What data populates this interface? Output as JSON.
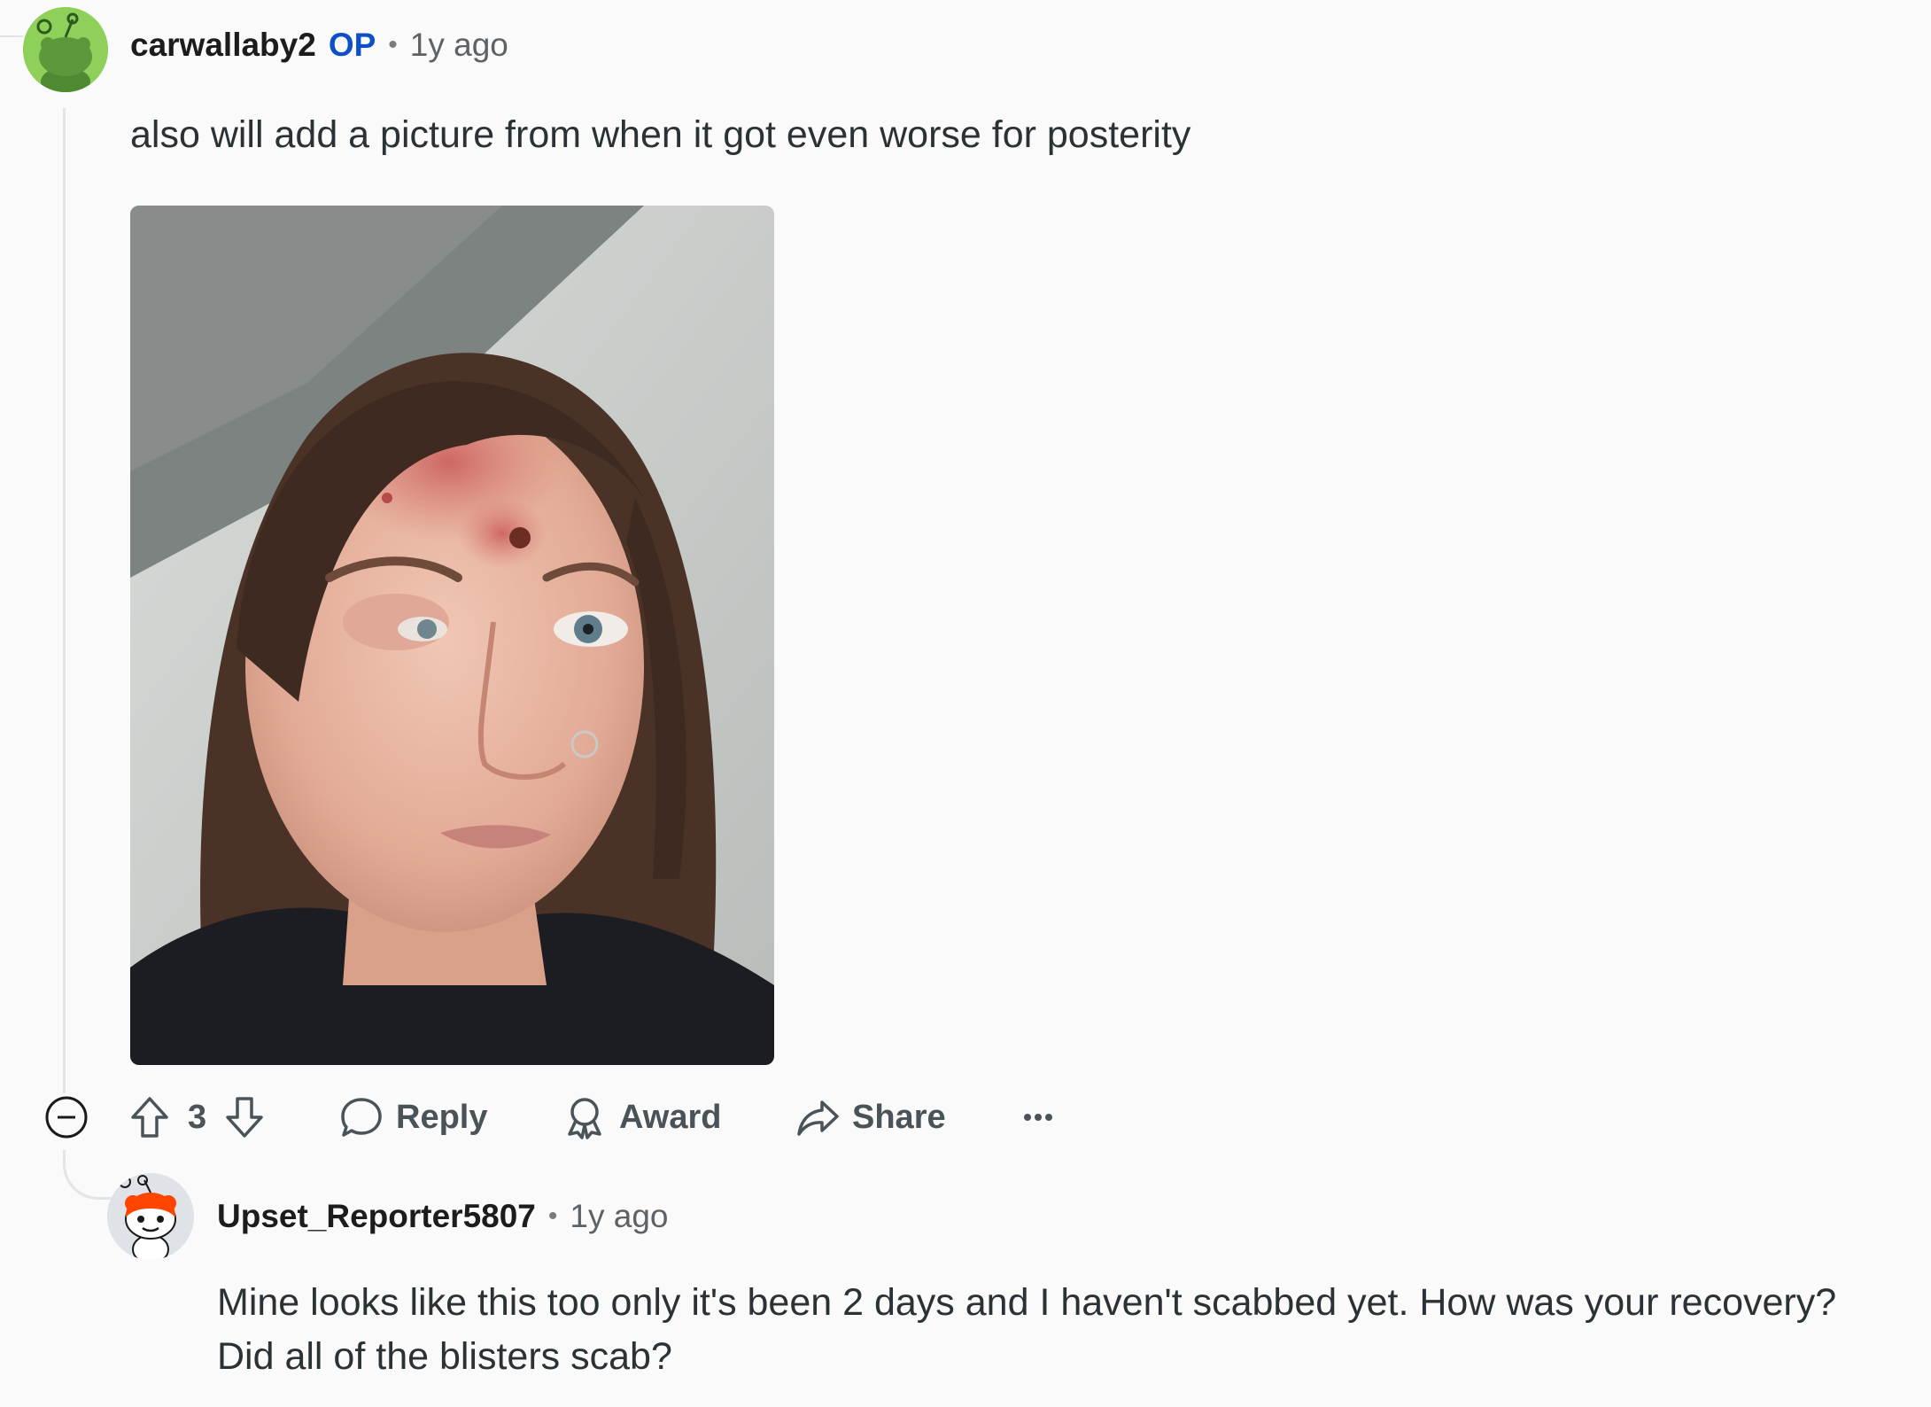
{
  "comments": [
    {
      "username": "carwallaby2",
      "op_badge": "OP",
      "separator": "•",
      "timestamp": "1y ago",
      "text": "also will add a picture from when it got even worse for posterity",
      "avatar_icon": "snoo-green-avatar",
      "image_icon": "selfie-photo",
      "actions": {
        "upvote_icon": "upvote-arrow-icon",
        "score": "3",
        "downvote_icon": "downvote-arrow-icon",
        "reply_label": "Reply",
        "award_label": "Award",
        "share_label": "Share",
        "more_icon": "ellipsis-icon"
      }
    },
    {
      "username": "Upset_Reporter5807",
      "separator": "•",
      "timestamp": "1y ago",
      "text_line1": "Mine looks like this too only it's been 2 days and I haven't scabbed yet. How was your recovery?",
      "text_line2": "Did all of the blisters scab?",
      "avatar_icon": "snoo-red-avatar"
    }
  ],
  "colors": {
    "background": "#fafafa",
    "op_badge": "#0e4fc5",
    "thread_line": "#e2e4e6",
    "muted_text": "#5c6266"
  }
}
